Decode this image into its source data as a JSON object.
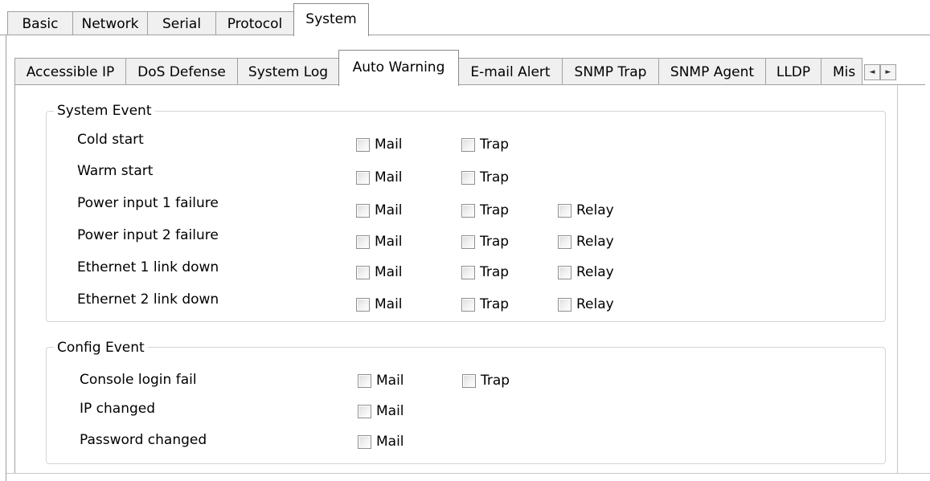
{
  "top_tabs": [
    "Basic",
    "Network",
    "Serial",
    "Protocol",
    "System"
  ],
  "top_tab_active": "System",
  "inner_tabs": [
    "Accessible IP",
    "DoS Defense",
    "System Log",
    "Auto Warning",
    "E-mail Alert",
    "SNMP Trap",
    "SNMP Agent",
    "LLDP",
    "Mis"
  ],
  "inner_tab_active": "Auto Warning",
  "scroll": {
    "left_icon": "◄",
    "right_icon": "►"
  },
  "system_event": {
    "title": "System Event",
    "rows": [
      {
        "label": "Cold start",
        "mail": "Mail",
        "trap": "Trap"
      },
      {
        "label": "Warm start",
        "mail": "Mail",
        "trap": "Trap"
      },
      {
        "label": "Power input 1 failure",
        "mail": "Mail",
        "trap": "Trap",
        "relay": "Relay"
      },
      {
        "label": "Power input 2 failure",
        "mail": "Mail",
        "trap": "Trap",
        "relay": "Relay"
      },
      {
        "label": "Ethernet 1 link down",
        "mail": "Mail",
        "trap": "Trap",
        "relay": "Relay"
      },
      {
        "label": "Ethernet 2 link down",
        "mail": "Mail",
        "trap": "Trap",
        "relay": "Relay"
      }
    ]
  },
  "config_event": {
    "title": "Config Event",
    "rows": [
      {
        "label": "Console login fail",
        "mail": "Mail",
        "trap": "Trap"
      },
      {
        "label": "IP changed",
        "mail": "Mail"
      },
      {
        "label": "Password changed",
        "mail": "Mail"
      }
    ]
  }
}
